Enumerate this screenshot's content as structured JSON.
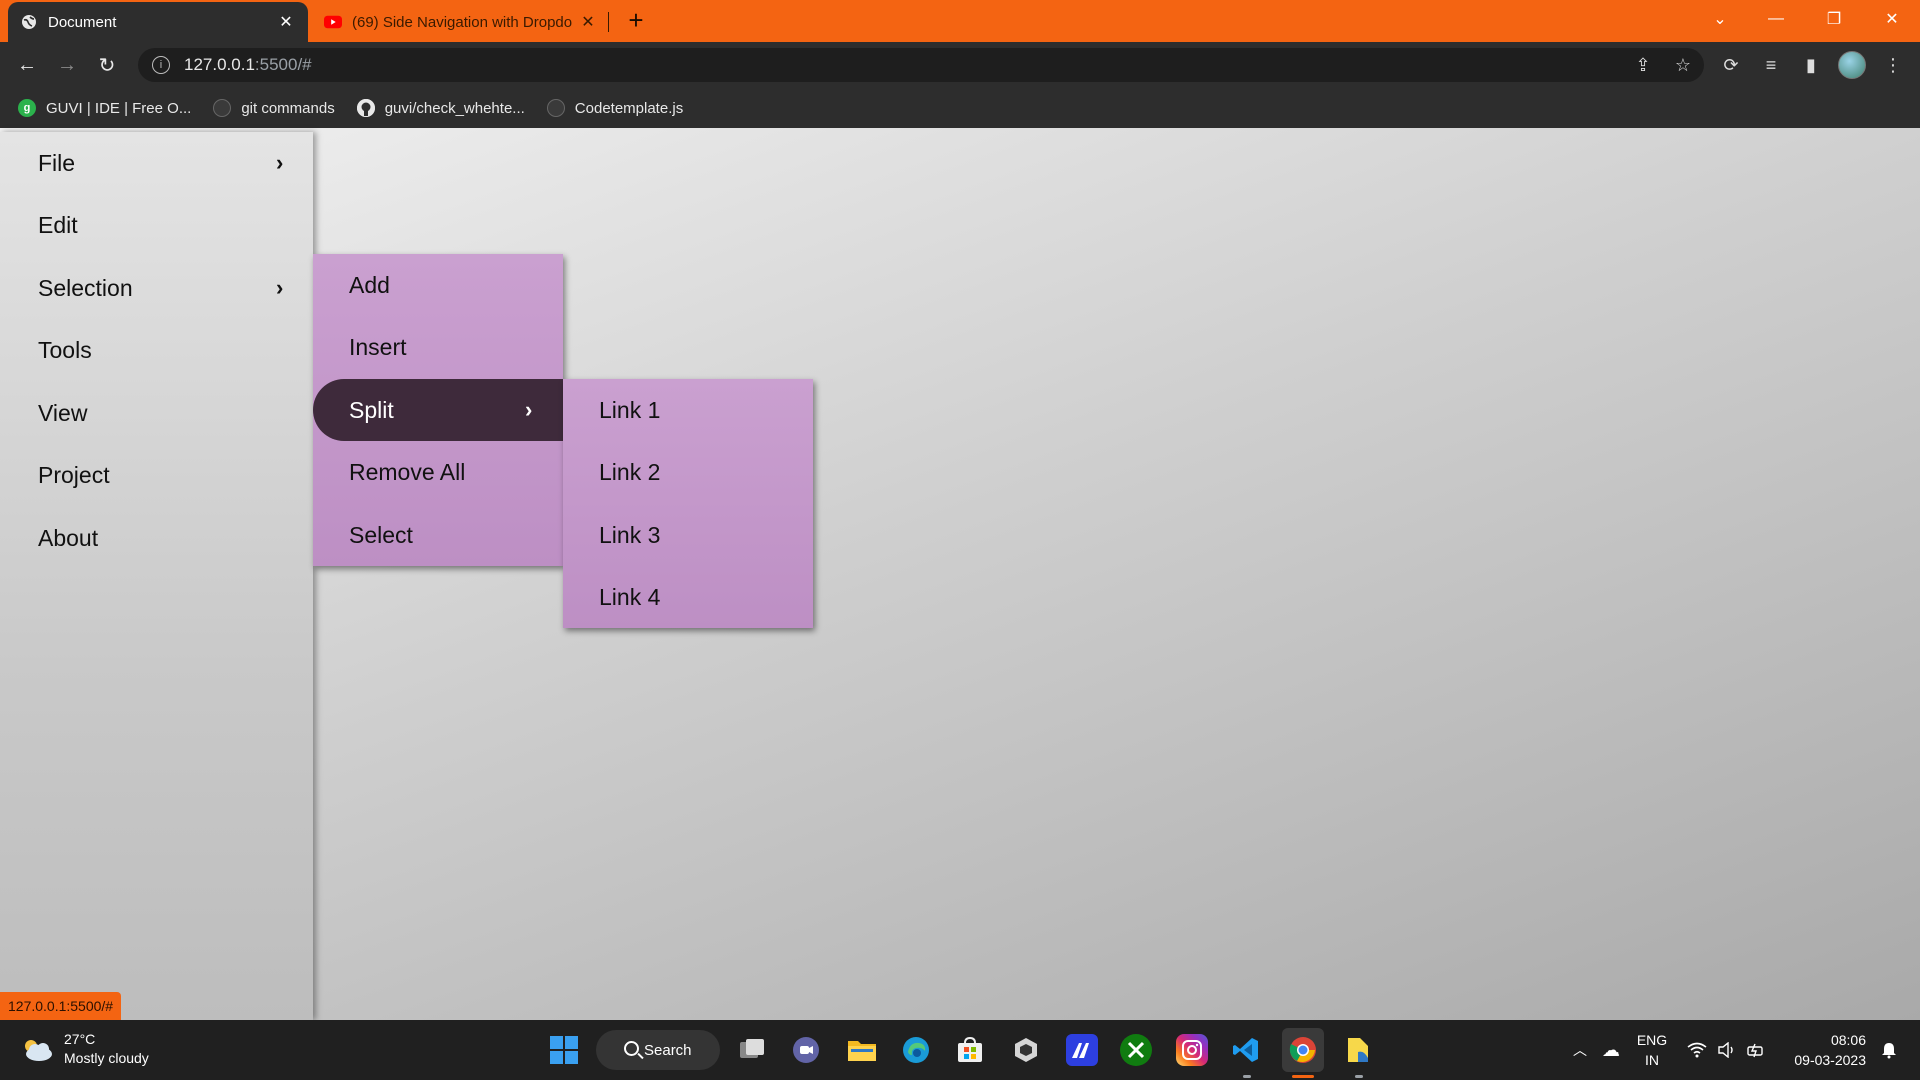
{
  "browser": {
    "tabs": [
      {
        "title": "Document",
        "active": true
      },
      {
        "title": "(69) Side Navigation with Dropdo",
        "active": false
      }
    ],
    "url_host": "127.0.0.1",
    "url_path": ":5500/#",
    "bookmarks": [
      {
        "label": "GUVI | IDE | Free O...",
        "icon": "guvi-icon"
      },
      {
        "label": "git commands",
        "icon": "github-icon"
      },
      {
        "label": "guvi/check_whehte...",
        "icon": "github-icon"
      },
      {
        "label": "Codetemplate.js",
        "icon": "github-icon"
      }
    ],
    "status_url": "127.0.0.1:5500/#",
    "accent_color": "#f46412"
  },
  "sidebar": {
    "items": [
      {
        "label": "File",
        "has_submenu": true
      },
      {
        "label": "Edit",
        "has_submenu": false
      },
      {
        "label": "Selection",
        "has_submenu": true
      },
      {
        "label": "Tools",
        "has_submenu": false
      },
      {
        "label": "View",
        "has_submenu": false
      },
      {
        "label": "Project",
        "has_submenu": false
      },
      {
        "label": "About",
        "has_submenu": false
      }
    ],
    "chevron": "›"
  },
  "selection_menu": {
    "items": [
      {
        "label": "Add"
      },
      {
        "label": "Insert"
      },
      {
        "label": "Split",
        "active": true,
        "has_submenu": true
      },
      {
        "label": "Remove All"
      },
      {
        "label": "Select"
      }
    ]
  },
  "split_menu": {
    "items": [
      {
        "label": "Link 1"
      },
      {
        "label": "Link 2"
      },
      {
        "label": "Link 3"
      },
      {
        "label": "Link 4"
      }
    ]
  },
  "taskbar": {
    "weather_temp": "27°C",
    "weather_desc": "Mostly cloudy",
    "search_label": "Search",
    "lang_line1": "ENG",
    "lang_line2": "IN",
    "time": "08:06",
    "date": "09-03-2023"
  }
}
